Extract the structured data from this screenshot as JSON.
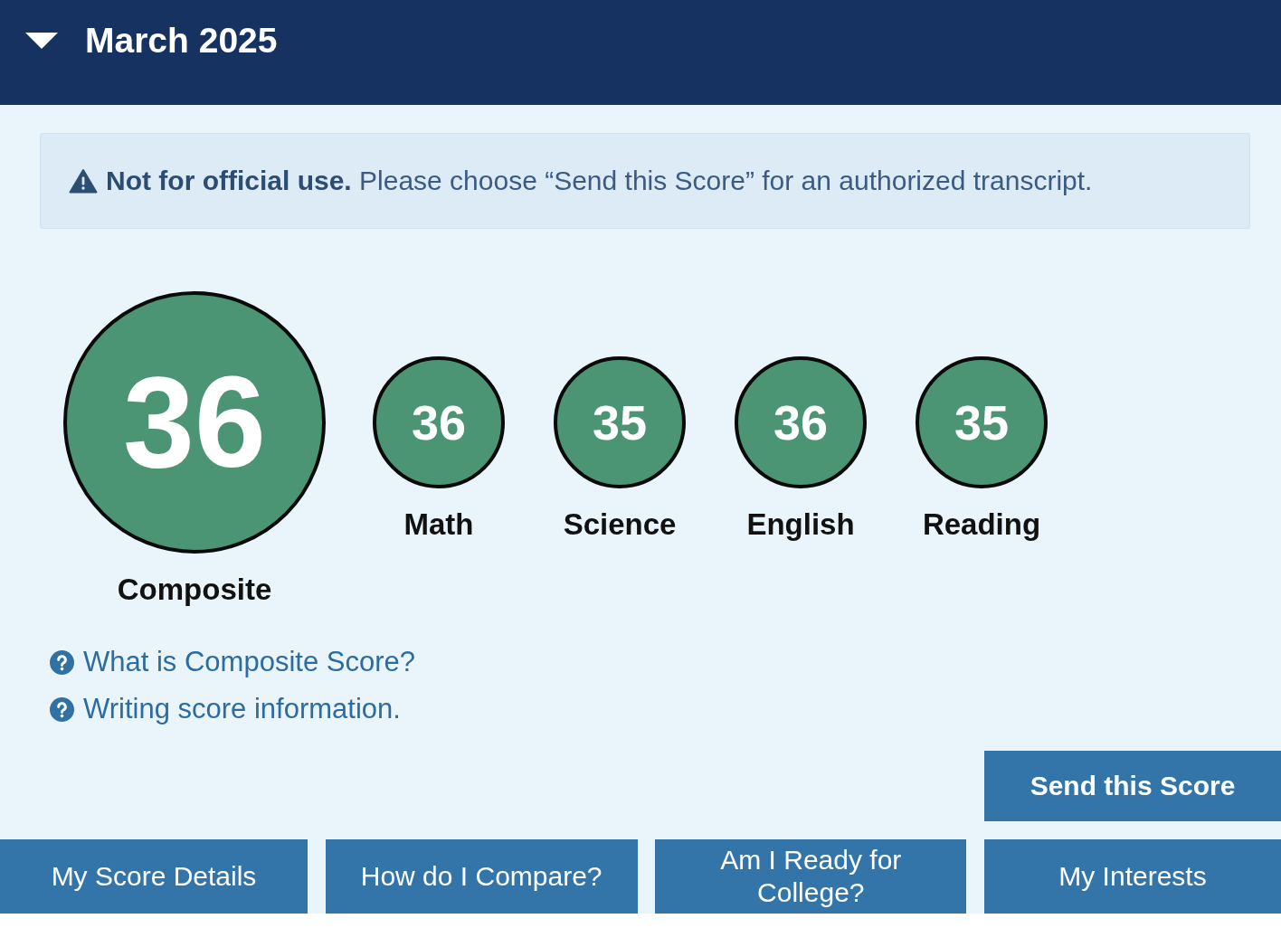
{
  "header": {
    "title": "March 2025",
    "expanded": true
  },
  "notice": {
    "text": "**Not for official use.** Please choose “Send this Score” for an authorized transcript."
  },
  "composite": {
    "score": "36",
    "label": "Composite"
  },
  "subscores": [
    {
      "score": "36",
      "label": "Math"
    },
    {
      "score": "35",
      "label": "Science"
    },
    {
      "score": "36",
      "label": "English"
    },
    {
      "score": "35",
      "label": "Reading"
    }
  ],
  "help_links": [
    {
      "label": "What is Composite Score?"
    },
    {
      "label": "Writing score information."
    }
  ],
  "send_button": {
    "label": "Send this Score"
  },
  "nav_buttons": [
    {
      "label": "My Score Details"
    },
    {
      "label": "How do I Compare?"
    },
    {
      "label": "Am I Ready for College?"
    },
    {
      "label": "My Interests"
    }
  ]
}
